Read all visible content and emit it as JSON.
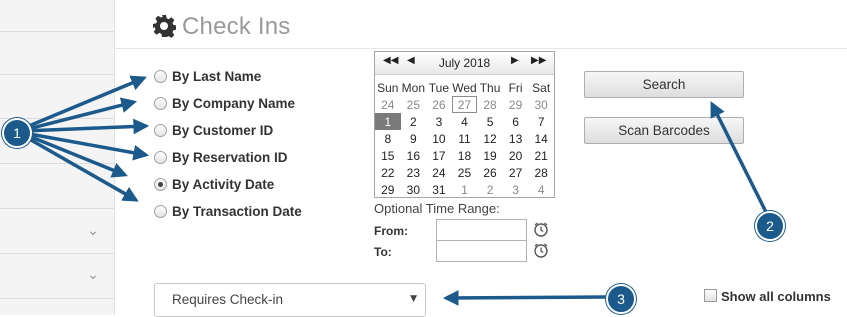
{
  "page": {
    "title": "Check Ins"
  },
  "search_options": [
    {
      "label": "By Last Name",
      "checked": false
    },
    {
      "label": "By Company Name",
      "checked": false
    },
    {
      "label": "By Customer ID",
      "checked": false
    },
    {
      "label": "By Reservation ID",
      "checked": false
    },
    {
      "label": "By Activity Date",
      "checked": true
    },
    {
      "label": "By Transaction Date",
      "checked": false
    }
  ],
  "calendar": {
    "nav_prev_year": "◀◀",
    "nav_prev_month": "◀",
    "nav_next_month": "▶",
    "nav_next_year": "▶▶",
    "month_label": "July 2018",
    "weekdays": [
      "Sun",
      "Mon",
      "Tue",
      "Wed",
      "Thu",
      "Fri",
      "Sat"
    ],
    "weeks": [
      [
        "24",
        "25",
        "26",
        "27",
        "28",
        "29",
        "30"
      ],
      [
        "1",
        "2",
        "3",
        "4",
        "5",
        "6",
        "7"
      ],
      [
        "8",
        "9",
        "10",
        "11",
        "12",
        "13",
        "14"
      ],
      [
        "15",
        "16",
        "17",
        "18",
        "19",
        "20",
        "21"
      ],
      [
        "22",
        "23",
        "24",
        "25",
        "26",
        "27",
        "28"
      ],
      [
        "29",
        "30",
        "31",
        "1",
        "2",
        "3",
        "4"
      ]
    ],
    "selected_day": "1",
    "outlined_day": "27"
  },
  "time_range": {
    "label": "Optional Time Range:",
    "from_label": "From:",
    "to_label": "To:",
    "from_value": "",
    "to_value": ""
  },
  "buttons": {
    "search": "Search",
    "scan": "Scan Barcodes"
  },
  "filter_select": {
    "value": "Requires Check-in"
  },
  "show_all_columns": {
    "label": "Show all columns",
    "checked": false
  },
  "annotations": {
    "badge1": "1",
    "badge2": "2",
    "badge3": "3"
  },
  "colors": {
    "accent": "#1d5a8c",
    "selected_day_bg": "#7a7a7a"
  }
}
